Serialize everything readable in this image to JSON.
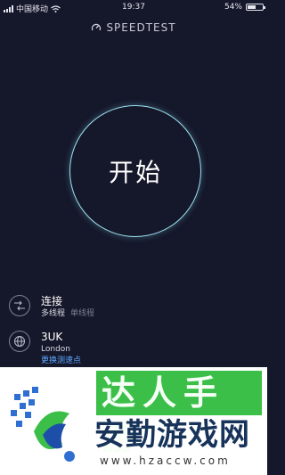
{
  "status_bar": {
    "carrier": "中国移动",
    "time": "19:37",
    "battery_text": "54%",
    "battery_level": 0.54
  },
  "header": {
    "brand": "SPEEDTEST"
  },
  "go_button": {
    "label": "开始"
  },
  "connection": {
    "title": "连接",
    "active_mode": "多线程",
    "inactive_mode": "单线程"
  },
  "server": {
    "name": "3UK",
    "location": "London",
    "change_link": "更换测速点"
  },
  "watermark": {
    "title_top": "达人手游",
    "title_main": "安勤游戏网",
    "url": "www.hzaccw.com"
  },
  "colors": {
    "background": "#15172a",
    "ring": "#9fe3f0",
    "link": "#5ea8ff",
    "watermark_green": "#3bbf49",
    "watermark_navy": "#17335a"
  }
}
